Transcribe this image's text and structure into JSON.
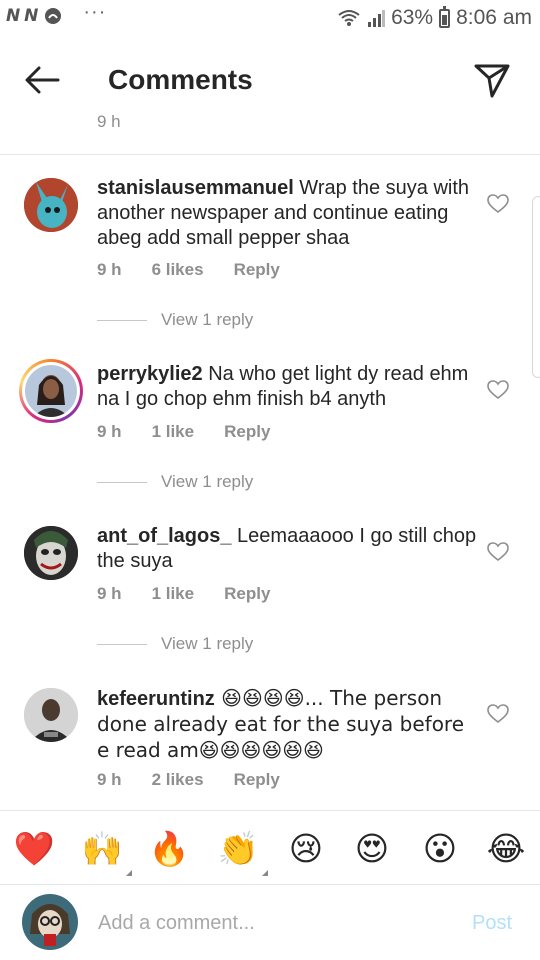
{
  "status_bar": {
    "left_icons": "N N",
    "dots": "···",
    "battery": "63%",
    "time": "8:06 am"
  },
  "header": {
    "title": "Comments",
    "partial_time": "9 h"
  },
  "comments": [
    {
      "username": "stanislausemmanuel",
      "text": " Wrap the suya with another newspaper and continue eating abeg add small pepper shaa",
      "time": "9 h",
      "likes": "6 likes",
      "reply": "Reply",
      "view_replies": "View 1 reply",
      "avatar_color": "#b2452e"
    },
    {
      "username": "perrykylie2",
      "text": " Na who get light dy read ehm na I go chop ehm finish b4 anyth",
      "time": "9 h",
      "likes": "1 like",
      "reply": "Reply",
      "view_replies": "View 1 reply",
      "avatar_color": "#a8bcd4"
    },
    {
      "username": "ant_of_lagos_",
      "text": " Leemaaaooo I go still chop the suya",
      "time": "9 h",
      "likes": "1 like",
      "reply": "Reply",
      "view_replies": "View 1 reply",
      "avatar_color": "#2b2b2b"
    },
    {
      "username": "kefeeruntinz",
      "text_line1": " 😆😆😆😆... The person done already eat for the suya before e read am😆😆😆😆😆😆",
      "time": "9 h",
      "likes": "2 likes",
      "reply": "Reply",
      "avatar_color": "#cfcfcf"
    }
  ],
  "reactions": [
    "❤️",
    "🙌",
    "🔥",
    "👏",
    "😢",
    "😍",
    "😮",
    "😂"
  ],
  "input": {
    "placeholder": "Add a comment...",
    "post_label": "Post"
  },
  "colors": {
    "text": "#262626",
    "secondary": "#8e8e8e",
    "post_disabled": "#b2dffc",
    "heart_red": "#e5202a"
  }
}
